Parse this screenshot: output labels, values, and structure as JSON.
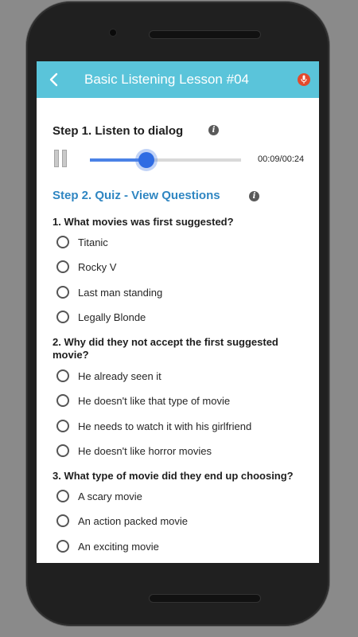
{
  "app": {
    "title": "Basic Listening Lesson #04",
    "back_icon": "back-arrow-icon",
    "mic_icon": "microphone-icon",
    "accent_color": "#5ac4da",
    "mic_color": "#e34a2c"
  },
  "step1": {
    "title": "Step 1. Listen to dialog",
    "player": {
      "state_icon": "pause-icon",
      "time": "00:09/00:24",
      "progress": 0.375
    }
  },
  "step2": {
    "title": "Step 2. Quiz - View Questions",
    "title_color": "#2f86c2"
  },
  "questions": [
    {
      "text": "1. What movies was first suggested?",
      "options": [
        "Titanic",
        "Rocky V",
        "Last man standing",
        "Legally Blonde"
      ]
    },
    {
      "text": "2. Why did they not accept the first suggested movie?",
      "options": [
        "He already seen it",
        "He doesn't like that type of movie",
        "He needs to watch it with his girlfriend",
        "He doesn't like horror movies"
      ]
    },
    {
      "text": "3. What type of movie did they end up choosing?",
      "options": [
        "A scary movie",
        "An action packed movie",
        "An exciting movie"
      ]
    }
  ]
}
